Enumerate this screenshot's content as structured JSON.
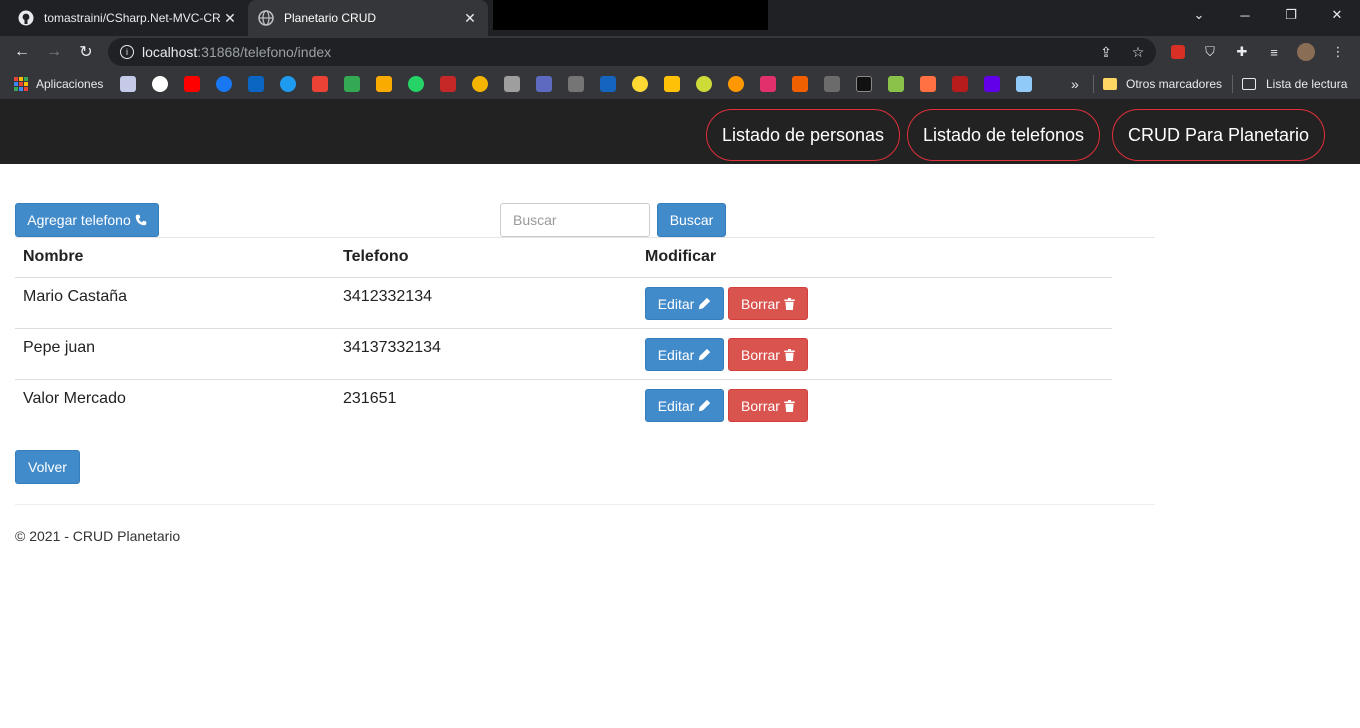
{
  "browser": {
    "tabs": [
      {
        "title": "tomastraini/CSharp.Net-MVC-CR"
      },
      {
        "title": "Planetario CRUD"
      }
    ],
    "url_host": "localhost",
    "url_rest": ":31868/telefono/index",
    "bookmarks": {
      "apps_label": "Aplicaciones",
      "other_label": "Otros marcadores",
      "reading_list_label": "Lista de lectura",
      "overflow": "»"
    }
  },
  "site_nav": {
    "items": [
      {
        "label": "Listado de personas"
      },
      {
        "label": "Listado de telefonos"
      },
      {
        "label": "CRUD Para Planetario"
      }
    ]
  },
  "actions": {
    "add_label": "Agregar telefono",
    "search_placeholder": "Buscar",
    "search_label": "Buscar",
    "back_label": "Volver"
  },
  "table": {
    "headers": [
      "Nombre",
      "Telefono",
      "Modificar"
    ],
    "rows": [
      {
        "nombre": "Mario Castaña",
        "telefono": "3412332134"
      },
      {
        "nombre": "Pepe juan",
        "telefono": "34137332134"
      },
      {
        "nombre": "Valor Mercado",
        "telefono": "231651"
      }
    ],
    "edit_label": "Editar",
    "delete_label": "Borrar"
  },
  "footer": {
    "text": "© 2021 - CRUD Planetario"
  },
  "colors": {
    "primary": "#428bca",
    "danger": "#d9534f",
    "nav_bg": "#222222",
    "pill_border": "#e0303a"
  }
}
